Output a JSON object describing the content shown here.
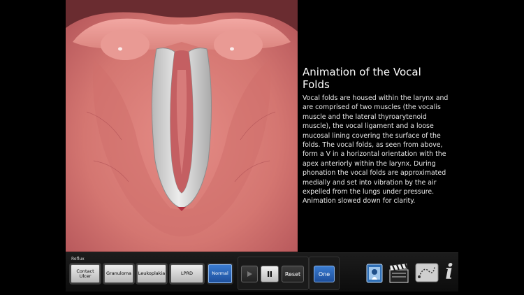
{
  "info": {
    "title": "Animation of the Vocal Folds",
    "body": "Vocal folds are housed within the larynx and are comprised of two muscles (the vocalis muscle and the lateral thyroarytenoid muscle), the vocal ligament and a loose mucosal lining covering the surface of the folds. The vocal folds, as seen from above, form a V in a horizontal orientation with the apex anteriorly within the larynx. During phonation the vocal folds are approximated medially and set into vibration by the air expelled from the lungs under pressure. Animation slowed down for clarity."
  },
  "toolbar": {
    "group_label": "Reflux",
    "conditions": [
      "Contact Ulcer",
      "Granuloma",
      "Leukoplakia",
      "LPRD",
      "Normal"
    ],
    "selected_condition": "Normal",
    "reset_label": "Reset",
    "mode_label": "One",
    "info_glyph": "i"
  },
  "icons": [
    "play-icon",
    "pause-icon",
    "stroboscope-icon",
    "clapperboard-icon",
    "path-icon",
    "info-icon"
  ],
  "colors": {
    "active_blue": "#2b66b8",
    "tissue": "#c76a66",
    "folds": "#d6d6d6"
  }
}
